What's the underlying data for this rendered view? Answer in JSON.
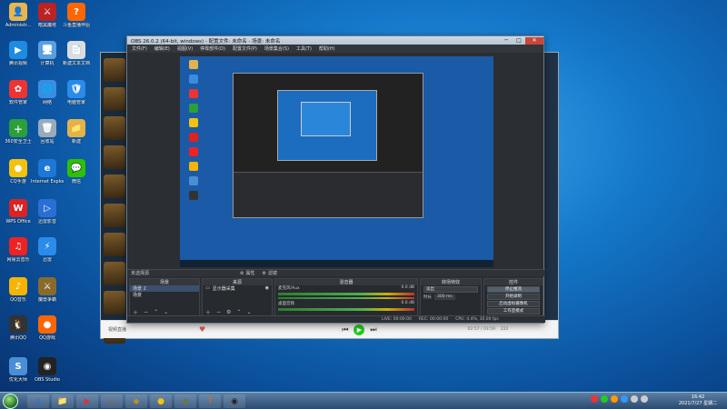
{
  "desktop": {
    "icons": [
      {
        "label": "Administr...",
        "color": "#e8b64a",
        "glyph": "👤"
      },
      {
        "label": "暗黑魔塔",
        "color": "#b22",
        "glyph": "⚔"
      },
      {
        "label": "斗鱼直播伴侣",
        "color": "#f60",
        "glyph": "?"
      },
      {
        "label": "腾讯视频",
        "color": "#1e8be0",
        "glyph": "▶"
      },
      {
        "label": "计算机",
        "color": "#5aa0e0",
        "glyph": "🖥"
      },
      {
        "label": "新建文本文档",
        "color": "#ddd",
        "glyph": "📄"
      },
      {
        "label": "软件管家",
        "color": "#e33",
        "glyph": "✿"
      },
      {
        "label": "网络",
        "color": "#3a8de0",
        "glyph": "🌐"
      },
      {
        "label": "电脑管家",
        "color": "#2a8be8",
        "glyph": "🛡"
      },
      {
        "label": "360安全卫士",
        "color": "#2c9e3a",
        "glyph": "＋"
      },
      {
        "label": "回收站",
        "color": "#9ab",
        "glyph": "🗑"
      },
      {
        "label": "新建",
        "color": "#e3b34a",
        "glyph": "📁"
      },
      {
        "label": "CQ手游",
        "color": "#f4c20d",
        "glyph": "●"
      },
      {
        "label": "Internet Explorer",
        "color": "#1c77d6",
        "glyph": "e"
      },
      {
        "label": "微信",
        "color": "#2dc100",
        "glyph": "💬"
      },
      {
        "label": "WPS Office",
        "color": "#d22",
        "glyph": "W"
      },
      {
        "label": "迅雷影音",
        "color": "#2a6fd6",
        "glyph": "▷"
      },
      {
        "label": "网易云音乐",
        "color": "#e22",
        "glyph": "♫"
      },
      {
        "label": "迅雷",
        "color": "#2b8be8",
        "glyph": "⚡"
      },
      {
        "label": "QQ音乐",
        "color": "#f5b400",
        "glyph": "♪"
      },
      {
        "label": "魔兽争霸",
        "color": "#8a6a2a",
        "glyph": "⚔"
      },
      {
        "label": "腾讯QQ",
        "color": "#333",
        "glyph": "🐧"
      },
      {
        "label": "QQ游戏",
        "color": "#f60",
        "glyph": "●"
      },
      {
        "label": "优化大师",
        "color": "#4a8fd6",
        "glyph": "S"
      },
      {
        "label": "OBS Studio",
        "color": "#222",
        "glyph": "◉"
      }
    ]
  },
  "obs": {
    "title": "OBS 26.0.2 (64-bit, windows) - 配置文件: 未命名 - 场景: 未命名",
    "menu": [
      "文件(F)",
      "编辑(E)",
      "视图(V)",
      "停靠部件(D)",
      "配置文件(P)",
      "场景集合(S)",
      "工具(T)",
      "帮助(H)"
    ],
    "toolbar": {
      "source_hint": "未选择源",
      "props": "属性",
      "filters": "滤镜"
    },
    "scenes": {
      "header": "场景",
      "items": [
        "场景 2",
        "场景"
      ]
    },
    "sources": {
      "header": "来源",
      "items": [
        "显示器采集"
      ]
    },
    "mixer": {
      "header": "混音器",
      "tracks": [
        {
          "name": "麦克风/Aux",
          "db": "0.0 dB"
        },
        {
          "name": "桌面音频",
          "db": "0.0 dB"
        }
      ]
    },
    "transitions": {
      "header": "转场特效",
      "type": "淡出",
      "duration_label": "时长",
      "duration": "300 ms"
    },
    "controls": {
      "header": "控件",
      "buttons": [
        "停止推流",
        "开始录制",
        "启动虚拟摄像机",
        "工作室模式",
        "设置",
        "退出"
      ]
    },
    "status": {
      "live": "LIVE: 00:00:00",
      "rec": "REC: 00:00:00",
      "cpu": "CPU: 4.4%, 30.00 fps"
    }
  },
  "bgapp": {
    "footer": "视频直播",
    "counter": "02:57 / 03:59",
    "count2": "222"
  },
  "taskbar": {
    "apps": [
      {
        "color": "#1c77d6",
        "glyph": "e"
      },
      {
        "color": "#e3b34a",
        "glyph": "📁"
      },
      {
        "color": "#d33",
        "glyph": "▶"
      },
      {
        "color": "#8a6a2a",
        "glyph": "⚔"
      },
      {
        "color": "#b7912a",
        "glyph": "◆"
      },
      {
        "color": "#f4c20d",
        "glyph": "●"
      },
      {
        "color": "#6a7a3a",
        "glyph": "◆"
      },
      {
        "color": "#f60",
        "glyph": "?"
      },
      {
        "color": "#222",
        "glyph": "◉"
      }
    ],
    "time": "16:42",
    "date": "2021/7/27 星期二"
  }
}
